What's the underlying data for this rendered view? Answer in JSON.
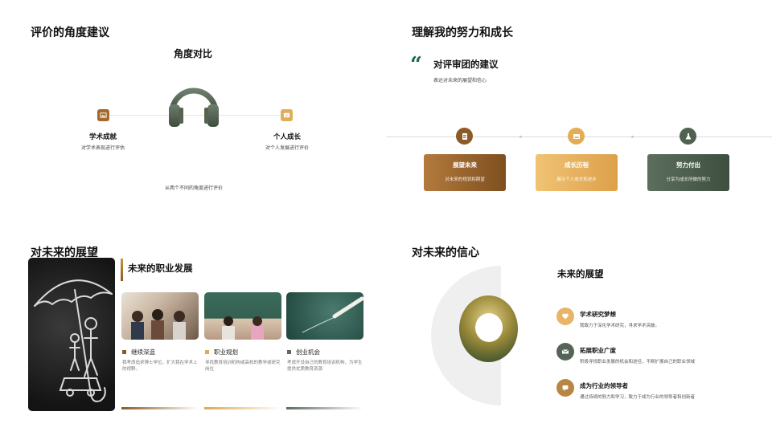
{
  "slide1": {
    "title": "评价的角度建议",
    "center_title": "角度对比",
    "left": {
      "title": "学术成就",
      "desc": "对学术表现进行评估"
    },
    "right": {
      "title": "个人成长",
      "desc": "对个人发展进行评价"
    },
    "footer": "从两个不同的角度进行评价",
    "icons": {
      "headphones": "headphones-icon",
      "left": "image-icon",
      "right": "message-icon"
    }
  },
  "slide2": {
    "title": "理解我的努力和成长",
    "subtitle": "对评审团的建议",
    "desc": "表达对未来的展望和信心",
    "cards": [
      {
        "title": "展望未来",
        "desc": "对未来的规划和期望",
        "icon": "document-icon"
      },
      {
        "title": "成长历程",
        "desc": "展示个人成长和进步",
        "icon": "image-icon"
      },
      {
        "title": "努力付出",
        "desc": "分享为成长所做的努力",
        "icon": "flask-icon"
      }
    ],
    "colors": {
      "quote": "#1e6b48",
      "brown": "#8b5a26",
      "gold": "#e4ad55",
      "green": "#4f6150"
    }
  },
  "slide3": {
    "title": "对未来的展望",
    "subtitle": "未来的职业发展",
    "columns": [
      {
        "title": "继续深造",
        "desc": "我考虑追求博士学位，扩大我在学术上的视野。",
        "color": "#8b5a26"
      },
      {
        "title": "职业规划",
        "desc": "寻找教育培训机构或高校的教学或研究岗位",
        "color": "#e0a84f"
      },
      {
        "title": "创业机会",
        "desc": "考虑开设自己的教育培训机构，为学生提供优质教育资源",
        "color": "#5d6b5c"
      }
    ]
  },
  "slide4": {
    "title": "对未来的信心",
    "subtitle": "未来的展望",
    "items": [
      {
        "title": "学术研究梦想",
        "desc": "我致力于深化学术研究，寻求学术突破。",
        "icon": "heart-icon"
      },
      {
        "title": "拓展职业广度",
        "desc": "积极寻找职业发展的机会和途径，不断扩展自己的职业领域",
        "icon": "mail-icon"
      },
      {
        "title": "成为行业的领导者",
        "desc": "通过持续的努力和学习，致力于成为行业的领导者和创新者",
        "icon": "chat-icon"
      }
    ]
  }
}
